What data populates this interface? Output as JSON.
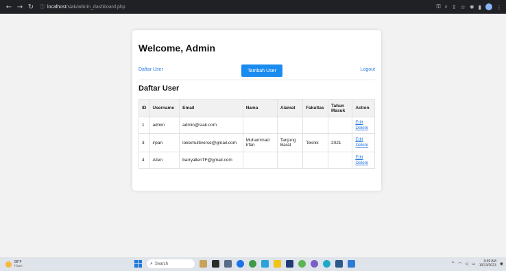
{
  "browser": {
    "url_host": "localhost",
    "url_path": "/siak/admin_dashboard.php"
  },
  "page": {
    "title": "Welcome, Admin",
    "nav": {
      "daftar_user": "Daftar User",
      "tambah_user": "Tambah User",
      "logout": "Logout"
    },
    "subtitle": "Daftar User",
    "table": {
      "headers": [
        "ID",
        "Username",
        "Email",
        "Nama",
        "Alamat",
        "Fakultas",
        "Tahun Masuk",
        "Action"
      ],
      "rows": [
        {
          "id": "1",
          "username": "admin",
          "email": "admin@siak.com",
          "nama": "",
          "alamat": "",
          "fakultas": "",
          "tahun": "",
          "edit": "Edit",
          "delete": "Delete"
        },
        {
          "id": "3",
          "username": "irpan",
          "email": "lokixmultiverse@gmail.com",
          "nama": "Muhammad Irfan",
          "alamat": "Tanjung Barat",
          "fakultas": "Teknik",
          "tahun": "2021",
          "edit": "Edit",
          "delete": "Delete"
        },
        {
          "id": "4",
          "username": "Allen",
          "email": "barryallenTF@gmail.com",
          "nama": "",
          "alamat": "",
          "fakultas": "",
          "tahun": "",
          "edit": "Edit",
          "delete": "Delete"
        }
      ]
    }
  },
  "taskbar": {
    "weather_temp": "88°F",
    "weather_desc": "Haze",
    "search_placeholder": "Search",
    "time": "3:49 AM",
    "date": "10/13/2023"
  },
  "colors": {
    "link": "#2d7be0",
    "primary_button": "#1a8cf0"
  }
}
